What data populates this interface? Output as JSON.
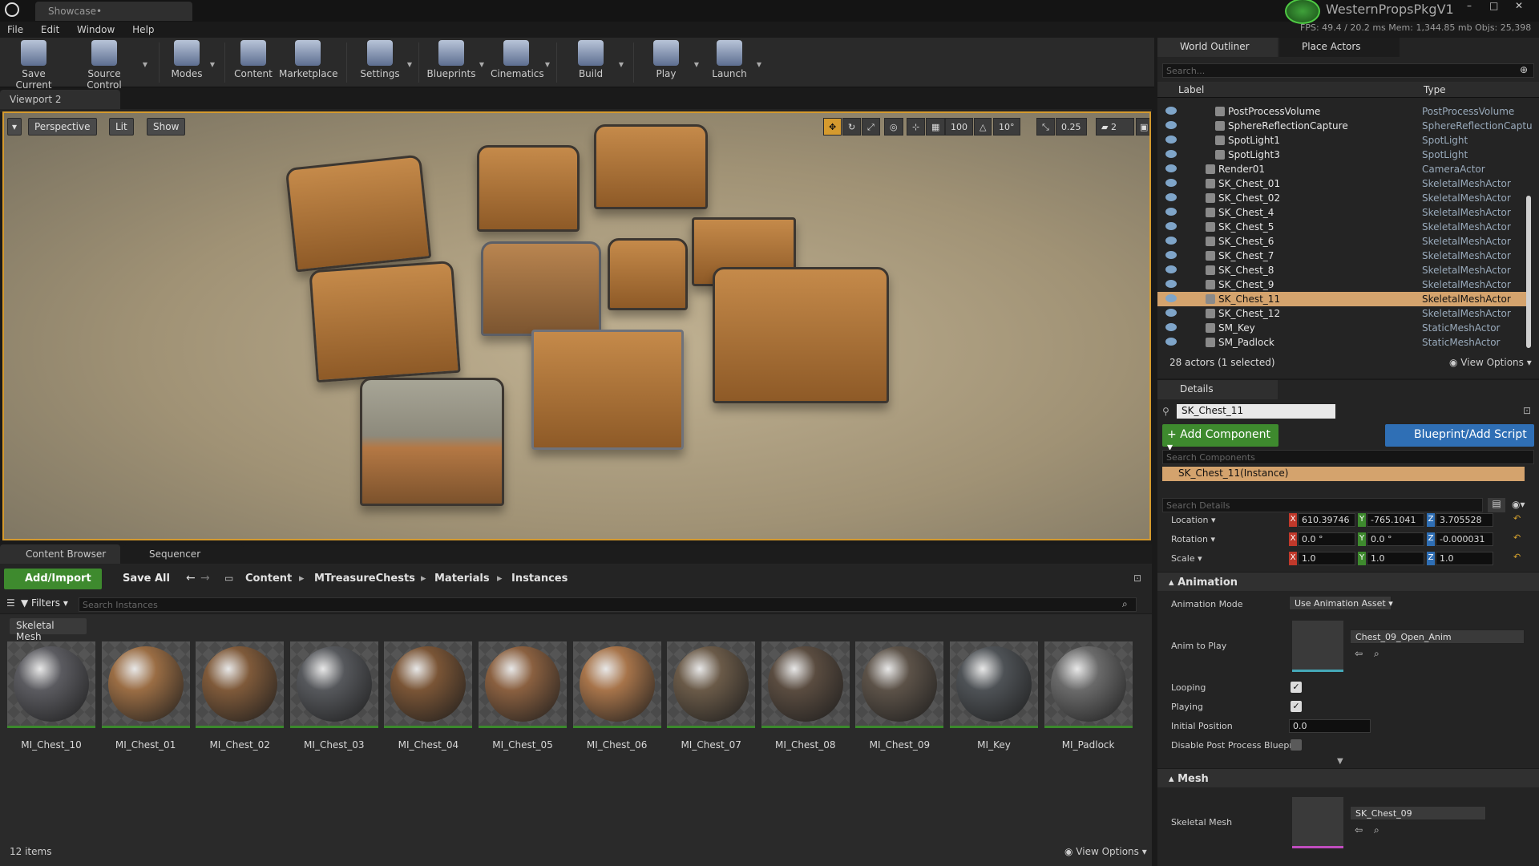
{
  "window": {
    "tab_title": "Showcase•",
    "project_name": "WesternPropsPkgV1",
    "stats": "FPS: 49.4 / 20.2 ms  Mem: 1,344.85 mb  Objs: 25,398"
  },
  "menu": [
    "File",
    "Edit",
    "Window",
    "Help"
  ],
  "toolbar": [
    "Save Current",
    "Source Control",
    "Modes",
    "Content",
    "Marketplace",
    "Settings",
    "Blueprints",
    "Cinematics",
    "Build",
    "Play",
    "Launch"
  ],
  "viewport": {
    "tab": "Viewport 2",
    "perspective": "Perspective",
    "lit": "Lit",
    "show": "Show",
    "grid_snap": "100",
    "rot_snap": "10°",
    "scale_snap": "0.25",
    "camera_speed": "2"
  },
  "content_browser": {
    "tab": "Content Browser",
    "tab2": "Sequencer",
    "add_import": "Add/Import",
    "save_all": "Save All",
    "path": [
      "Content",
      "MTreasureChests",
      "Materials",
      "Instances"
    ],
    "filters": "Filters",
    "search_placeholder": "Search Instances",
    "filter_chip": "Skeletal Mesh",
    "assets": [
      {
        "name": "MI_Chest_10",
        "color": "#5b5b60"
      },
      {
        "name": "MI_Chest_01",
        "color": "#9a6d44"
      },
      {
        "name": "MI_Chest_02",
        "color": "#7f5a3a"
      },
      {
        "name": "MI_Chest_03",
        "color": "#56585c"
      },
      {
        "name": "MI_Chest_04",
        "color": "#7a5536"
      },
      {
        "name": "MI_Chest_05",
        "color": "#8a6040"
      },
      {
        "name": "MI_Chest_06",
        "color": "#a7744a"
      },
      {
        "name": "MI_Chest_07",
        "color": "#6a5a48"
      },
      {
        "name": "MI_Chest_08",
        "color": "#5a4c40"
      },
      {
        "name": "MI_Chest_09",
        "color": "#5c5248"
      },
      {
        "name": "MI_Key",
        "color": "#4e5256"
      },
      {
        "name": "MI_Padlock",
        "color": "#6a6a6a"
      }
    ],
    "item_count": "12 items",
    "view_options": "View Options"
  },
  "outliner": {
    "tab": "World Outliner",
    "tab2": "Place Actors",
    "search_placeholder": "Search...",
    "col_label": "Label",
    "col_type": "Type",
    "rows": [
      {
        "label": "PostProcessVolume",
        "type": "PostProcessVolume"
      },
      {
        "label": "SphereReflectionCapture",
        "type": "SphereReflectionCaptu"
      },
      {
        "label": "SpotLight1",
        "type": "SpotLight"
      },
      {
        "label": "SpotLight3",
        "type": "SpotLight"
      },
      {
        "label": "Render01",
        "type": "CameraActor"
      },
      {
        "label": "SK_Chest_01",
        "type": "SkeletalMeshActor"
      },
      {
        "label": "SK_Chest_02",
        "type": "SkeletalMeshActor"
      },
      {
        "label": "SK_Chest_4",
        "type": "SkeletalMeshActor"
      },
      {
        "label": "SK_Chest_5",
        "type": "SkeletalMeshActor"
      },
      {
        "label": "SK_Chest_6",
        "type": "SkeletalMeshActor"
      },
      {
        "label": "SK_Chest_7",
        "type": "SkeletalMeshActor"
      },
      {
        "label": "SK_Chest_8",
        "type": "SkeletalMeshActor"
      },
      {
        "label": "SK_Chest_9",
        "type": "SkeletalMeshActor"
      },
      {
        "label": "SK_Chest_11",
        "type": "SkeletalMeshActor"
      },
      {
        "label": "SK_Chest_12",
        "type": "SkeletalMeshActor"
      },
      {
        "label": "SM_Key",
        "type": "StaticMeshActor"
      },
      {
        "label": "SM_Padlock",
        "type": "StaticMeshActor"
      }
    ],
    "selected_label": "SK_Chest_11",
    "actor_count": "28 actors (1 selected)",
    "view_options": "View Options"
  },
  "details": {
    "tab": "Details",
    "name": "SK_Chest_11",
    "add_component": "+ Add Component",
    "blueprint_script": "Blueprint/Add Script",
    "search_components": "Search Components",
    "component_instance": "SK_Chest_11(Instance)",
    "search_details": "Search Details",
    "location_label": "Location",
    "rotation_label": "Rotation",
    "scale_label": "Scale",
    "location": [
      "610.39746",
      "-765.1041",
      "3.705528"
    ],
    "rotation": [
      "0.0 °",
      "0.0 °",
      "-0.000031"
    ],
    "scale": [
      "1.0",
      "1.0",
      "1.0"
    ],
    "animation_section": "Animation",
    "animation_mode_label": "Animation Mode",
    "animation_mode": "Use Animation Asset",
    "anim_to_play_label": "Anim to Play",
    "anim_to_play": "Chest_09_Open_Anim",
    "looping_label": "Looping",
    "playing_label": "Playing",
    "initial_position_label": "Initial Position",
    "initial_position": "0.0",
    "disable_pp_label": "Disable Post Process Bluepri",
    "mesh_section": "Mesh",
    "skeletal_mesh_label": "Skeletal Mesh",
    "skeletal_mesh": "SK_Chest_09"
  },
  "colors": {
    "accent_green": "#3e8a2e",
    "accent_blue": "#2f6fb5",
    "selection": "#d4a36d",
    "viewport_border": "#d59a2e"
  }
}
